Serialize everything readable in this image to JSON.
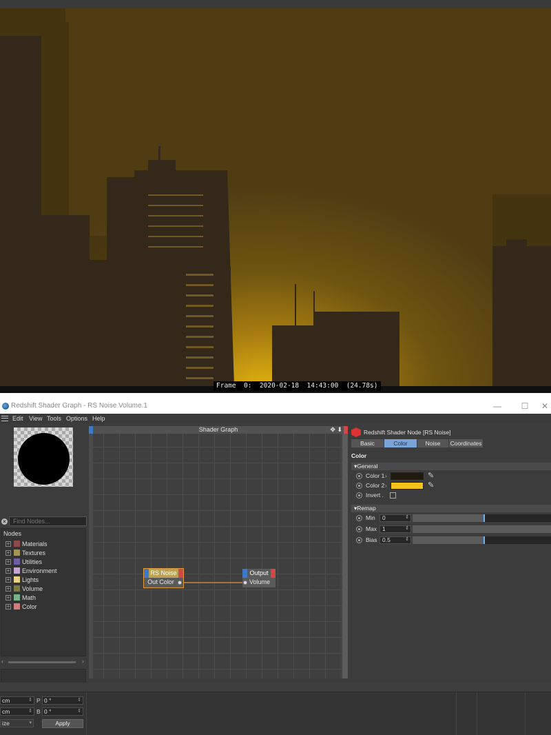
{
  "viewport": {
    "frame_info": "Frame  0:  2020-02-18  14:43:00  (24.78s)"
  },
  "window": {
    "title": "Redshift Shader Graph - RS Noise Volume.1",
    "minimize": "—",
    "maximize": "☐",
    "close": "✕"
  },
  "menu": {
    "edit": "Edit",
    "view": "View",
    "tools": "Tools",
    "options": "Options",
    "help": "Help"
  },
  "left_panel": {
    "find_placeholder": "Find Nodes...",
    "find_value": "Find Nodes...",
    "nodes_header": "Nodes",
    "categories": [
      {
        "label": "Materials",
        "color": "#8e4a4a"
      },
      {
        "label": "Textures",
        "color": "#a59452"
      },
      {
        "label": "Utilities",
        "color": "#6e5fa3"
      },
      {
        "label": "Environment",
        "color": "#c7a6d6"
      },
      {
        "label": "Lights",
        "color": "#e7d089"
      },
      {
        "label": "Volume",
        "color": "#7c7a45"
      },
      {
        "label": "Math",
        "color": "#78b48a"
      },
      {
        "label": "Color",
        "color": "#cf7c7c"
      }
    ],
    "scroll_left": "‹",
    "scroll_right": "›"
  },
  "graph": {
    "title": "Shader Graph",
    "controls": "✥ ⬇",
    "nodes": [
      {
        "title": "RS Noise",
        "port": "Out Color",
        "head_color": "#b9a253"
      },
      {
        "title": "Output",
        "port": "Volume",
        "head_color": "#5a5a5a"
      }
    ],
    "wire_color": "#e09a3a"
  },
  "attributes": {
    "header": "Redshift Shader Node [RS Noise]",
    "tabs": [
      "Basic",
      "Color",
      "Noise",
      "Coordinates"
    ],
    "active_tab": "Color",
    "section": "Color",
    "general_group": "General",
    "color1_label": "Color 1",
    "color1_value": "#1e1a10",
    "color2_label": "Color 2",
    "color2_value": "#f4c21a",
    "invert_label": "Invert .",
    "remap_group": "Remap",
    "chevron": "›",
    "dropper_icon": "✎",
    "remap": [
      {
        "label": "Min",
        "value": "0",
        "fill": 0.5
      },
      {
        "label": "Max",
        "value": "1",
        "fill": 1.0
      },
      {
        "label": "Bias",
        "value": "0.5",
        "fill": 0.5
      }
    ]
  },
  "lower": {
    "row1_a": "cm",
    "row1_label": "P",
    "row1_b": "0 °",
    "row2_a": "cm",
    "row2_label": "B",
    "row2_b": "0 °",
    "mode": "ize",
    "apply": "Apply"
  }
}
